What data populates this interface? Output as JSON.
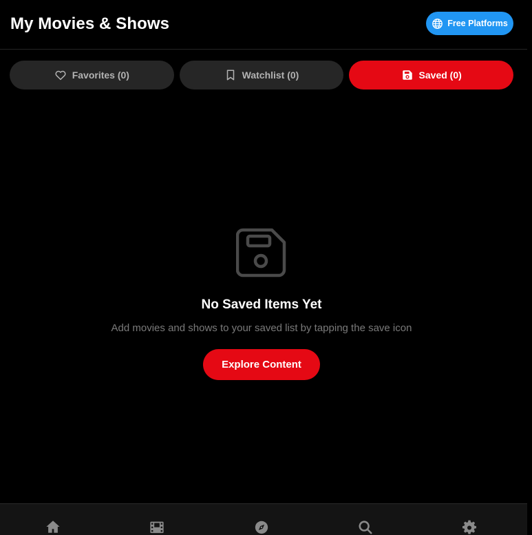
{
  "header": {
    "title": "My Movies & Shows",
    "platforms_button": {
      "label": "Free Platforms",
      "icon": "globe-icon",
      "color": "#2196f3"
    }
  },
  "tabs": [
    {
      "label": "Favorites (0)",
      "icon": "heart-icon",
      "active": false
    },
    {
      "label": "Watchlist (0)",
      "icon": "bookmark-icon",
      "active": false
    },
    {
      "label": "Saved (0)",
      "icon": "save-icon",
      "active": true
    }
  ],
  "empty_state": {
    "icon": "floppy-disk-icon",
    "title": "No Saved Items Yet",
    "message": "Add movies and shows to your saved list by tapping the save icon",
    "button_label": "Explore Content"
  },
  "bottom_nav": [
    {
      "icon": "home-icon"
    },
    {
      "icon": "film-icon"
    },
    {
      "icon": "compass-icon"
    },
    {
      "icon": "search-icon"
    },
    {
      "icon": "gear-icon"
    }
  ],
  "colors": {
    "accent": "#e50914",
    "platforms": "#2196f3",
    "background": "#000000",
    "tab_inactive": "#262626"
  }
}
